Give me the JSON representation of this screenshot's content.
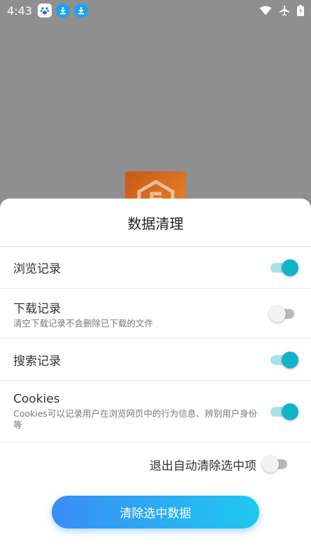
{
  "status_bar": {
    "time": "4:43",
    "notification_icons": [
      "baidu-icon",
      "download-icon",
      "download-icon"
    ],
    "system_icons": [
      "wifi-icon",
      "airplane-icon",
      "battery-icon"
    ]
  },
  "dialog": {
    "title": "数据清理",
    "items": [
      {
        "label": "浏览记录",
        "sub": "",
        "checked": true
      },
      {
        "label": "下载记录",
        "sub": "清空下载记录不会删除已下载的文件",
        "checked": false
      },
      {
        "label": "搜索记录",
        "sub": "",
        "checked": true
      },
      {
        "label": "Cookies",
        "sub": "Cookies可以记录用户在浏览网页中的行为信息、辨别用户身份等",
        "checked": true
      }
    ],
    "auto_clear": {
      "label": "退出自动清除选中项",
      "checked": false
    },
    "clear_button": "清除选中数据"
  },
  "colors": {
    "accent": "#10b4c6",
    "button_start": "#3a8cf5",
    "button_end": "#1fc9f0"
  }
}
